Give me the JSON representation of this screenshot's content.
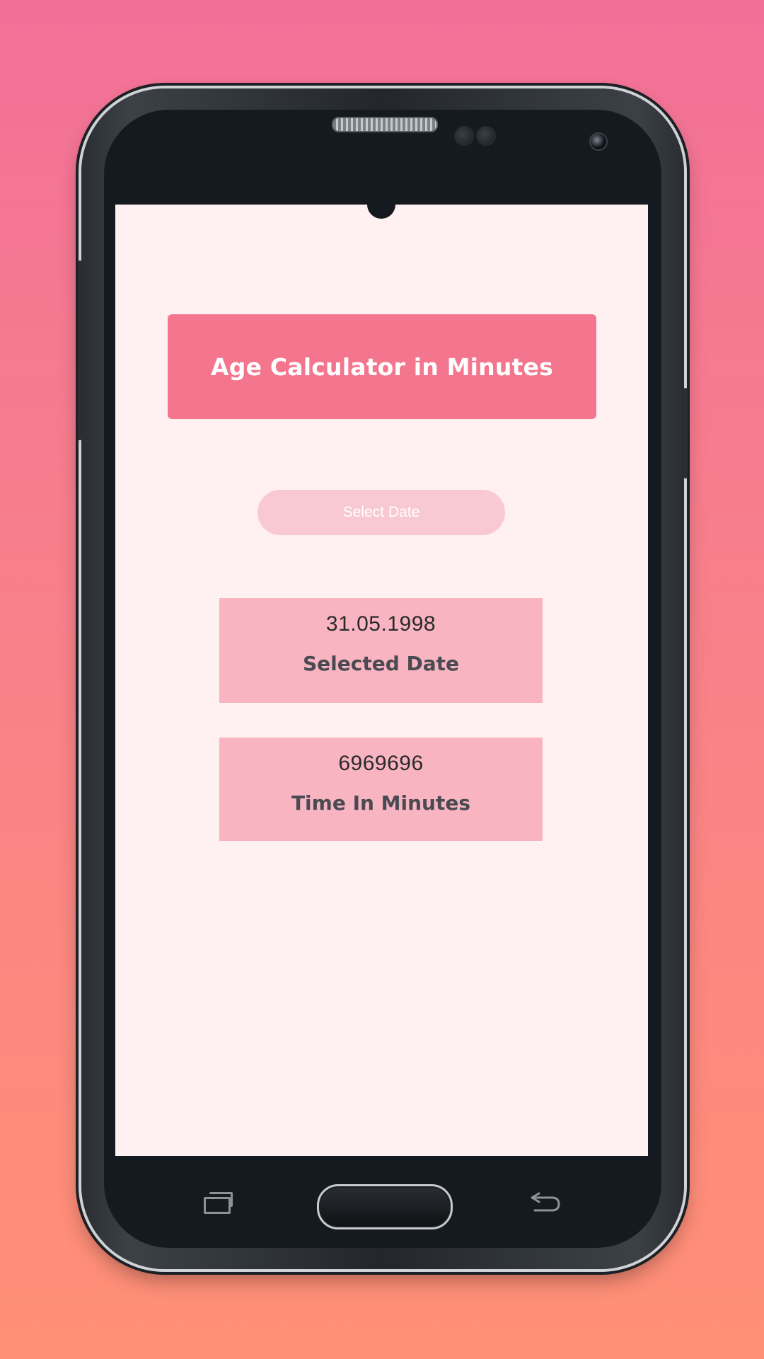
{
  "app": {
    "title": "Age Calculator in Minutes",
    "select_button_label": "Select Date",
    "selected_date": {
      "value": "31.05.1998",
      "label": "Selected Date"
    },
    "minutes": {
      "value": "6969696",
      "label": "Time In Minutes"
    }
  },
  "colors": {
    "background_top": "#f27098",
    "background_bottom": "#ff9075",
    "screen": "#fff0f2",
    "title_card": "#f4768e",
    "select_button": "#f9c9d3",
    "info_card": "#f9b4c2"
  },
  "nav_icons": [
    "recent-apps-icon",
    "home-button",
    "back-icon"
  ]
}
